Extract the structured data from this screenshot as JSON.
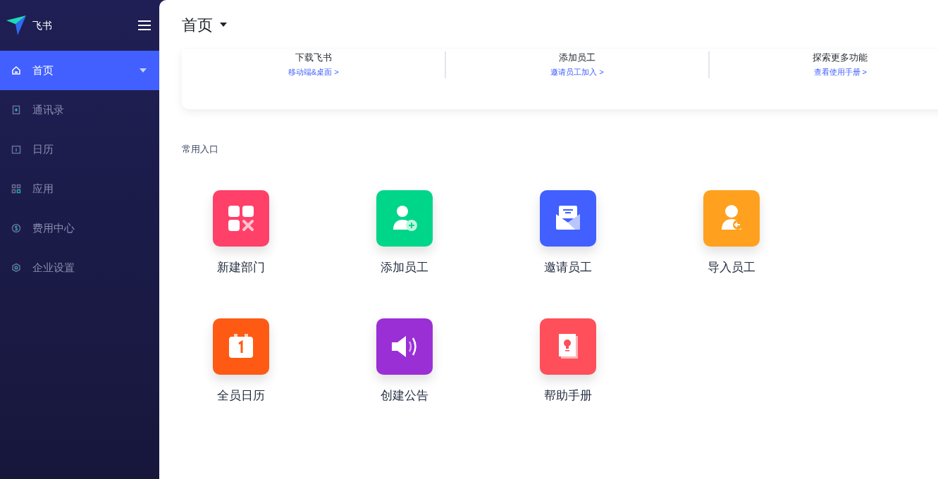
{
  "app": {
    "name": "飞书"
  },
  "sidebar": {
    "items": [
      {
        "label": "首页",
        "kind": "home",
        "selected": true,
        "expandable": true
      },
      {
        "label": "通讯录",
        "kind": "contacts",
        "selected": false
      },
      {
        "label": "日历",
        "kind": "calendar",
        "selected": false
      },
      {
        "label": "应用",
        "kind": "apps",
        "selected": false
      },
      {
        "label": "费用中心",
        "kind": "dollar",
        "selected": false
      },
      {
        "label": "企业设置",
        "kind": "hexagon",
        "selected": false
      }
    ]
  },
  "header": {
    "title": "首页"
  },
  "quick_links": [
    {
      "title": "下载飞书",
      "link": "移动端&桌面 >"
    },
    {
      "title": "添加员工",
      "link": "邀请员工加入 >"
    },
    {
      "title": "探索更多功能",
      "link": "查看使用手册 >"
    }
  ],
  "shortcuts": {
    "title": "常用入口",
    "items": [
      {
        "label": "新建部门",
        "kind": "department",
        "color": "#ff4069"
      },
      {
        "label": "添加员工",
        "kind": "add-user",
        "color": "#00d68a"
      },
      {
        "label": "邀请员工",
        "kind": "mail",
        "color": "#4160ff"
      },
      {
        "label": "导入员工",
        "kind": "import-user",
        "color": "#ffa01e"
      },
      {
        "label": "全员日历",
        "kind": "calendar",
        "color": "#ff5a14"
      },
      {
        "label": "创建公告",
        "kind": "speaker",
        "color": "#9b2fd6"
      },
      {
        "label": "帮助手册",
        "kind": "book",
        "color": "#ff4f5a"
      }
    ]
  }
}
